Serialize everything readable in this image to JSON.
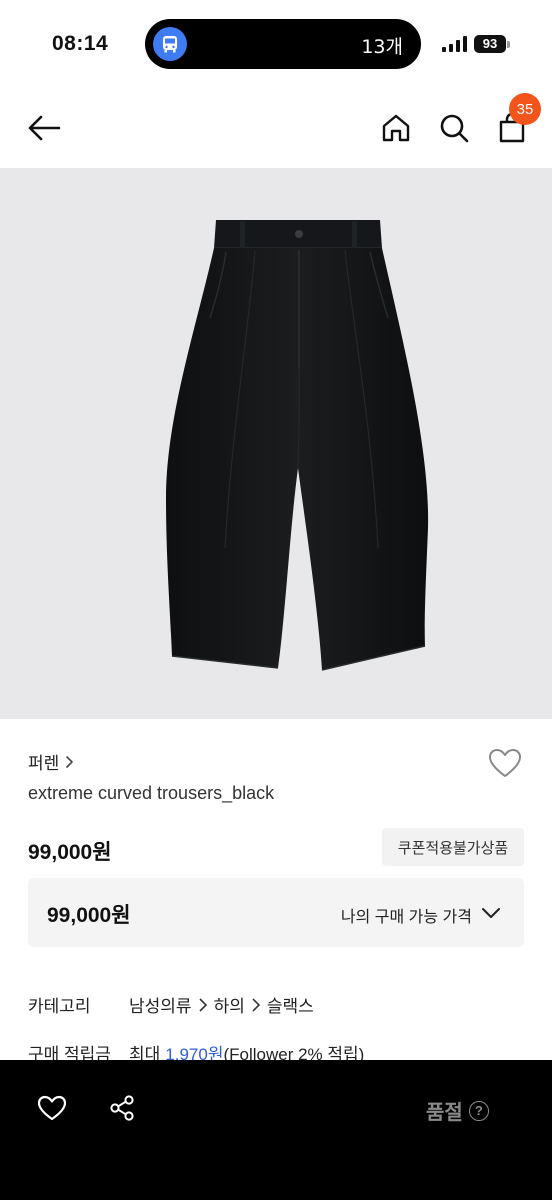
{
  "status_bar": {
    "time": "08:14",
    "island_text": "13개",
    "battery": "93"
  },
  "nav": {
    "cart_count": "35"
  },
  "product": {
    "brand": "퍼렌",
    "name": "extreme curved trousers_black",
    "price": "99,000원",
    "coupon_label": "쿠폰적용불가상품",
    "buy_price": "99,000원",
    "buy_label": "나의 구매 가능 가격"
  },
  "details": {
    "category_label": "카테고리",
    "category_path": [
      "남성의류",
      "하의",
      "슬랙스"
    ],
    "points_label": "구매 적립금",
    "points_prefix": "최대",
    "points_amount": "1,970원",
    "points_suffix": "(Follower 2% 적립)"
  },
  "bottom_bar": {
    "status": "품절"
  },
  "colors": {
    "badge": "#f2541b",
    "link_blue": "#2f5fd0",
    "bus_icon": "#3f7cf4"
  }
}
